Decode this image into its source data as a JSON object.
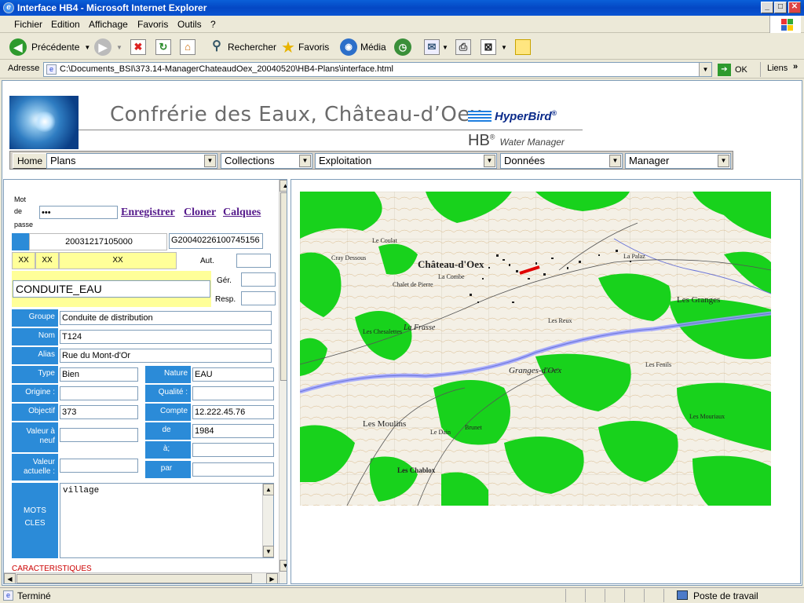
{
  "window": {
    "title": "Interface HB4 - Microsoft Internet Explorer",
    "minimize": "_",
    "maximize": "□",
    "close": "✕"
  },
  "menu": [
    "Fichier",
    "Edition",
    "Affichage",
    "Favoris",
    "Outils",
    "?"
  ],
  "toolbar": {
    "back": "Précédente",
    "search": "Rechercher",
    "favorites": "Favoris",
    "media": "Média"
  },
  "address": {
    "label": "Adresse",
    "url": "C:\\Documents_BSI\\373.14-ManagerChateaudOex_20040520\\HB4-Plans\\interface.html",
    "go": "OK",
    "links": "Liens"
  },
  "header": {
    "title": "Confrérie des Eaux, Château-d’Oex",
    "brand": "HyperBird",
    "brand_mark": "®",
    "product_main": "HB",
    "product_sub": "Water Manager"
  },
  "nav": {
    "home": "Home",
    "plans": "Plans",
    "collections": "Collections",
    "exploitation": "Exploitation",
    "donnees": "Données",
    "manager": "Manager"
  },
  "login": {
    "label_1": "Mot",
    "label_2": "de",
    "label_3": "passe",
    "password": "•••",
    "enregistrer": "Enregistrer",
    "cloner": "Cloner",
    "calques": "Calques"
  },
  "record": {
    "id1": "20031217105000",
    "id2": "G20040226100745156",
    "xx1": "XX",
    "xx2": "XX",
    "xx3": "XX",
    "aut": "Aut.",
    "ger": "Gér.",
    "resp": "Resp.",
    "name": "CONDUITE_EAU"
  },
  "fields": {
    "groupe_label": "Groupe",
    "groupe": "Conduite de distribution",
    "nom_label": "Nom",
    "nom": "T124",
    "alias_label": "Alias",
    "alias": "Rue du Mont-d'Or",
    "type_label": "Type",
    "type": "Bien",
    "nature_label": "Nature",
    "nature": "EAU",
    "origine_label": "Origine :",
    "qualite_label": "Qualité :",
    "objectif_label": "Objectif",
    "objectif": "373",
    "compte_label": "Compte",
    "compte": "12.222.45.76",
    "valeur_neuf_1": "Valeur à",
    "valeur_neuf_2": "neuf",
    "de_label": "de",
    "de": "1984",
    "a_label": "à;",
    "valeur_act_1": "Valeur",
    "valeur_act_2": "actuelle :",
    "par_label": "par",
    "mots_1": "MOTS",
    "mots_2": "CLES",
    "mots_cles": "village",
    "caracteristiques": "CARACTERISTIQUES"
  },
  "map_labels": {
    "town": "Château-d'Oex",
    "granges": "Les Granges",
    "granges_oex": "Granges-d'Oex",
    "moulins": "Les Moulins",
    "frasse": "La Frasse",
    "chesaletes": "Les Chesalettes",
    "reux": "Les Reux",
    "combe": "La Combe",
    "chalet_pierre": "Chalet de Pierre",
    "cray": "Cray Dessous",
    "coulat": "Le Coulat",
    "chablox": "Les Chablox",
    "brunet": "Brunet",
    "dain": "Le Dain",
    "mouriaux": "Les Mouriaux",
    "fenils": "Les Fenils",
    "palaz": "La Palaz"
  },
  "status": {
    "text": "Terminé",
    "zone": "Poste de travail"
  }
}
